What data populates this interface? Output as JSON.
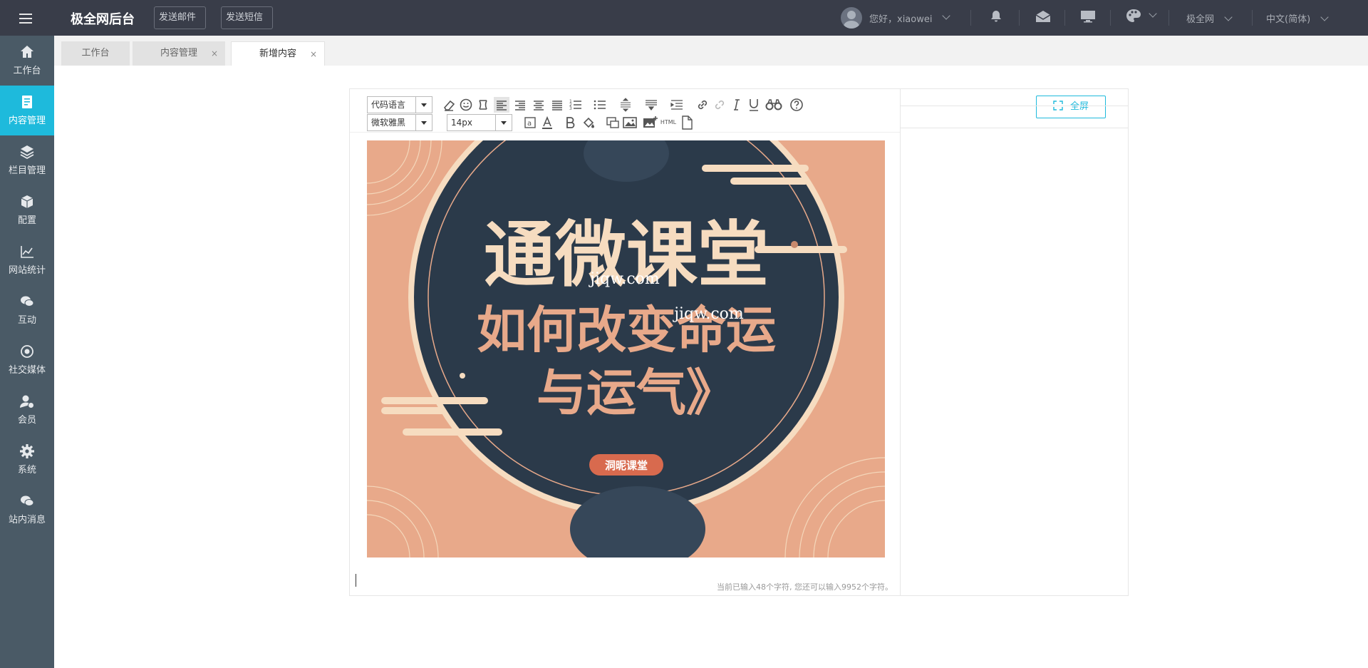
{
  "header": {
    "brand": "极全网后台",
    "send_mail": "发送邮件",
    "send_sms": "发送短信",
    "greeting": "您好，xiaowei",
    "site": "极全网",
    "language": "中文(简体)"
  },
  "sidebar": {
    "items": [
      {
        "label": "工作台",
        "icon": "home-icon"
      },
      {
        "label": "内容管理",
        "icon": "document-icon",
        "active": true
      },
      {
        "label": "栏目管理",
        "icon": "layers-icon"
      },
      {
        "label": "配置",
        "icon": "cube-icon"
      },
      {
        "label": "网站统计",
        "icon": "line-chart-icon"
      },
      {
        "label": "互动",
        "icon": "chat-icon"
      },
      {
        "label": "社交媒体",
        "icon": "target-icon"
      },
      {
        "label": "会员",
        "icon": "member-icon"
      },
      {
        "label": "系统",
        "icon": "gear-icon"
      },
      {
        "label": "站内消息",
        "icon": "message-icon"
      }
    ]
  },
  "tabs": [
    {
      "label": "工作台"
    },
    {
      "label": "内容管理",
      "close": "×"
    },
    {
      "label": "新增内容",
      "close": "×",
      "active": true
    }
  ],
  "editor": {
    "code_language": "代码语言",
    "font_family": "微软雅黑",
    "font_size": "14px",
    "html_label": "HTML",
    "image": {
      "title": "通微课堂",
      "subtitle_line1": "如何改变命运",
      "subtitle_line2": "与运气》",
      "badge": "洞昵课堂",
      "watermark1": "jiqw.com",
      "watermark2": "jiqw.com"
    },
    "word_count": "当前已输入48个字符, 您还可以输入9952个字符。"
  },
  "fullscreen_button": "全屏",
  "colors": {
    "topbar": "#393d49",
    "sidebar": "#4a5a66",
    "accent": "#1ebadc",
    "poster_bg": "#e8a98a",
    "poster_circle": "#2b3a4a",
    "poster_cream": "#f6dcc0"
  }
}
